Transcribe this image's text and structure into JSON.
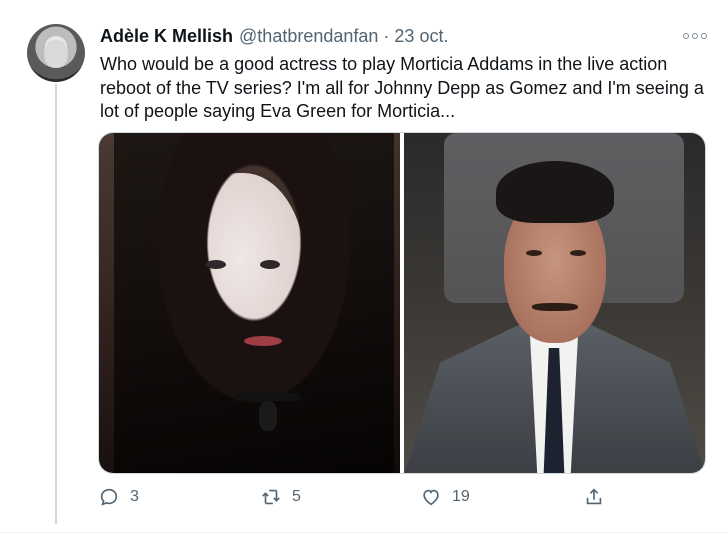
{
  "tweet": {
    "author_name": "Adèle K Mellish",
    "handle": "@thatbrendanfan",
    "separator": "·",
    "date": "23 oct.",
    "text": "Who would be a good actress to play Morticia Addams in the live action reboot of the TV series? I'm all for Johnny Depp as Gomez and I'm seeing a lot of people saying Eva Green for Morticia...",
    "media": [
      {
        "icon": "photo-woman-dark-hair"
      },
      {
        "icon": "photo-man-moustache-suit"
      }
    ],
    "actions": {
      "reply_count": "3",
      "retweet_count": "5",
      "like_count": "19"
    }
  },
  "icons": {
    "more": "more-options-icon",
    "reply": "reply-icon",
    "retweet": "retweet-icon",
    "like": "heart-icon",
    "share": "share-icon"
  },
  "colors": {
    "text_primary": "#0f1419",
    "text_secondary": "#536471",
    "border": "#cfd9de"
  }
}
